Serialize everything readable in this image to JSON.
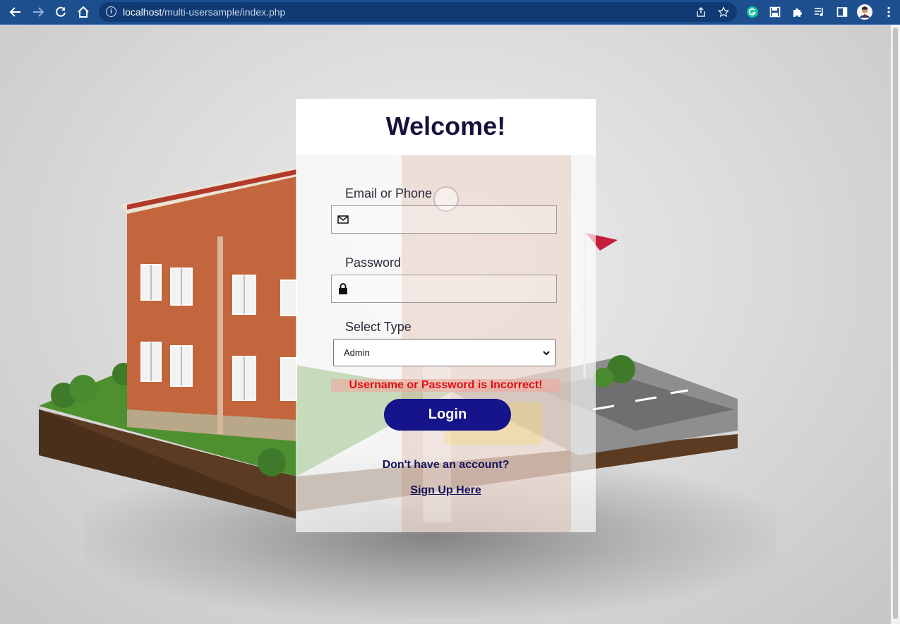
{
  "browser": {
    "url_host": "localhost",
    "url_path": "/multi-usersample/index.php",
    "icons": {
      "back": "arrow-left-icon",
      "forward": "arrow-right-icon",
      "reload": "reload-icon",
      "home": "home-icon",
      "info": "info-icon",
      "share": "share-icon",
      "bookmark": "star-icon",
      "grammarly": "grammarly-icon",
      "save": "floppy-icon",
      "extensions": "puzzle-icon",
      "media": "media-queue-icon",
      "sidepanel": "side-panel-icon",
      "profile": "avatar",
      "menu": "kebab-menu-icon"
    }
  },
  "login": {
    "title": "Welcome!",
    "email_label": "Email or Phone",
    "email_value": "",
    "password_label": "Password",
    "password_value": "",
    "type_label": "Select Type",
    "type_selected": "Admin",
    "error_message": "Username or Password is Incorrect!",
    "login_button": "Login",
    "signup_prompt": "Don't have an account?",
    "signup_link": "Sign Up Here"
  },
  "colors": {
    "chrome": "#1d4f8f",
    "button": "#15148a",
    "error_text": "#e01010",
    "title_text": "#17123a"
  }
}
